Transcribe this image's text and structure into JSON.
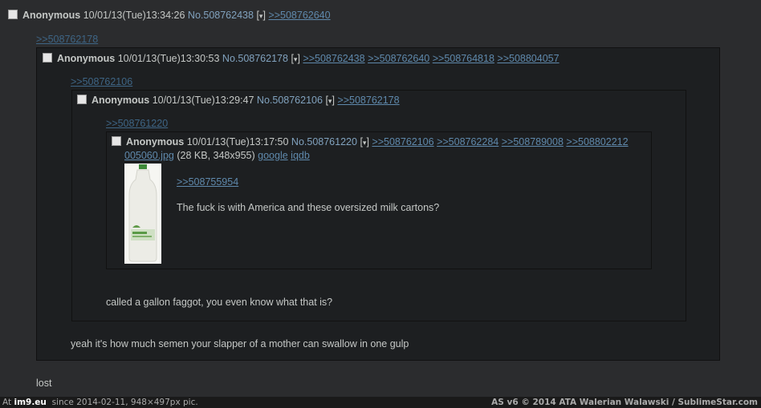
{
  "post1": {
    "name": "Anonymous",
    "date": "10/01/13(Tue)13:34:26",
    "number": "No.508762438",
    "menu_arrow": "▾",
    "replies": [
      ">>508762640"
    ],
    "backlink": ">>508762178",
    "comment": "lost"
  },
  "post2": {
    "name": "Anonymous",
    "date": "10/01/13(Tue)13:30:53",
    "number": "No.508762178",
    "menu_arrow": "▾",
    "replies": [
      ">>508762438",
      ">>508762640",
      ">>508764818",
      ">>508804057"
    ],
    "backlink": ">>508762106",
    "comment": "yeah it's how much semen your slapper of a mother can swallow in one gulp"
  },
  "post3": {
    "name": "Anonymous",
    "date": "10/01/13(Tue)13:29:47",
    "number": "No.508762106",
    "menu_arrow": "▾",
    "replies": [
      ">>508762178"
    ],
    "backlink": ">>508761220",
    "comment": "called a gallon faggot, you even know what that is?"
  },
  "post4": {
    "name": "Anonymous",
    "date": "10/01/13(Tue)13:17:50",
    "number": "No.508761220",
    "menu_arrow": "▾",
    "replies": [
      ">>508762106",
      ">>508762284",
      ">>508789008",
      ">>508802212"
    ],
    "file_name": "005060.jpg",
    "file_meta": "(28 KB, 348x955)",
    "file_search_1": "google",
    "file_search_2": "iqdb",
    "quote": ">>508755954",
    "comment": "The fuck is with America and these oversized milk cartons?"
  },
  "footer": {
    "left_prefix": "At",
    "left_site": "im9.eu",
    "left_rest": "since 2014-02-11, 948×497px pic.",
    "right": "AS v6 © 2014 ATA Walerian Walawski / SublimeStar.com"
  },
  "colors": {
    "background": "#2b2c2e",
    "post_background": "#1d1f21",
    "link": "#5f89ac",
    "post_number": "#81a2be"
  }
}
